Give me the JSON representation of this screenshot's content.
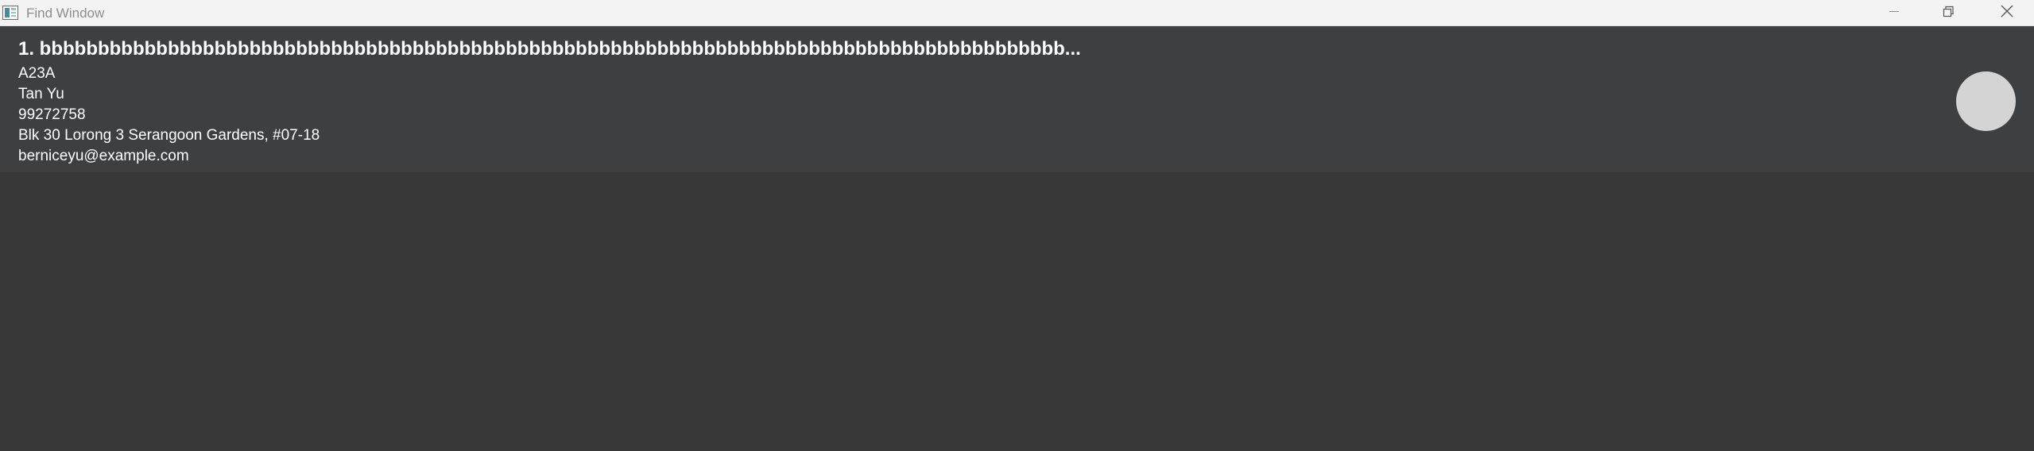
{
  "window": {
    "title": "Find Window",
    "controls": {
      "minimize": "minimize-icon",
      "maximize": "restore-icon",
      "close": "close-icon"
    }
  },
  "person_card": {
    "index_name": "1. bbbbbbbbbbbbbbbbbbbbbbbbbbbbbbbbbbbbbbbbbbbbbbbbbbbbbbbbbbbbbbbbbbbbbbbbbbbbbbbbbbbbbbbb...",
    "unit": "A23A",
    "contact_name": "Tan Yu",
    "phone": "99272758",
    "address": "Blk 30 Lorong 3 Serangoon Gardens, #07-18",
    "email": "berniceyu@example.com"
  },
  "colors": {
    "titlebar_bg": "#f3f3f3",
    "window_bg": "#383838",
    "card_bg": "#3e3f41",
    "text": "#ffffff",
    "avatar": "#d4d4d4"
  }
}
